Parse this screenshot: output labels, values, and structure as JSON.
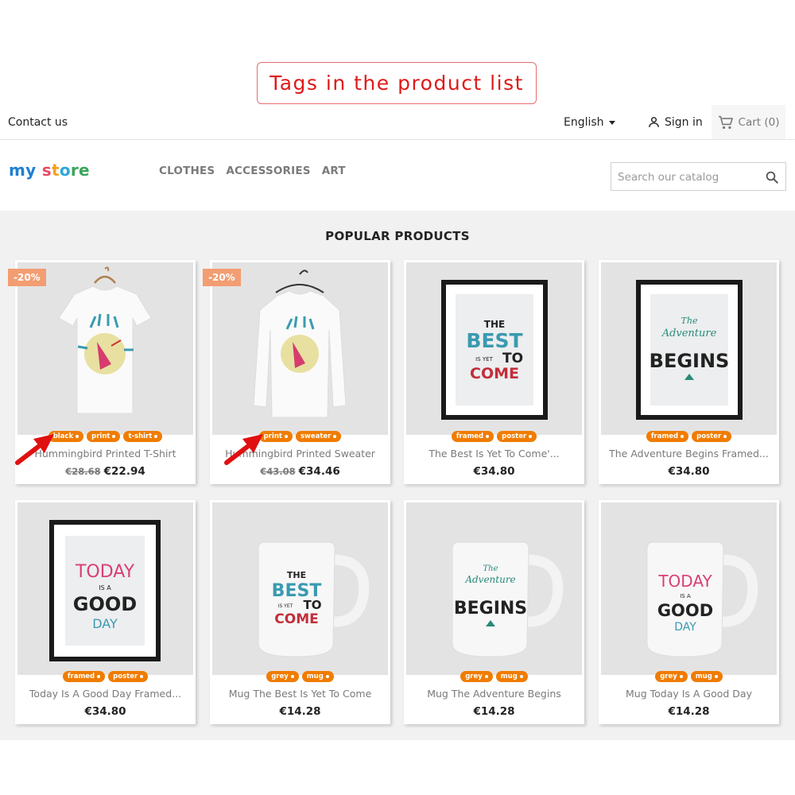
{
  "callout": {
    "text": "Tags in the product list"
  },
  "topbar": {
    "contact": "Contact us",
    "language": "English",
    "signin": "Sign in",
    "cart": "Cart (0)"
  },
  "header": {
    "logo": {
      "part1": "my",
      "part2": " s",
      "part3": "t",
      "part4": "o",
      "part5": "re"
    },
    "nav": [
      "CLOTHES",
      "ACCESSORIES",
      "ART"
    ],
    "search_placeholder": "Search our catalog"
  },
  "section_title": "POPULAR PRODUCTS",
  "products": [
    {
      "name": "Hummingbird Printed T-Shirt",
      "old_price": "€28.68",
      "price": "€22.94",
      "discount": "-20%",
      "tags": [
        "black",
        "print",
        "t-shirt"
      ],
      "image": "t-shirt"
    },
    {
      "name": "Hummingbird Printed Sweater",
      "old_price": "€43.08",
      "price": "€34.46",
      "discount": "-20%",
      "tags": [
        "print",
        "sweater"
      ],
      "image": "sweater"
    },
    {
      "name": "The Best Is Yet To Come'...",
      "price": "€34.80",
      "tags": [
        "framed",
        "poster"
      ],
      "image": "frame-best"
    },
    {
      "name": "The Adventure Begins Framed...",
      "price": "€34.80",
      "tags": [
        "framed",
        "poster"
      ],
      "image": "frame-adventure"
    },
    {
      "name": "Today Is A Good Day Framed...",
      "price": "€34.80",
      "tags": [
        "framed",
        "poster"
      ],
      "image": "frame-today"
    },
    {
      "name": "Mug The Best Is Yet To Come",
      "price": "€14.28",
      "tags": [
        "grey",
        "mug"
      ],
      "image": "mug-best"
    },
    {
      "name": "Mug The Adventure Begins",
      "price": "€14.28",
      "tags": [
        "grey",
        "mug"
      ],
      "image": "mug-adventure"
    },
    {
      "name": "Mug Today Is A Good Day",
      "price": "€14.28",
      "tags": [
        "grey",
        "mug"
      ],
      "image": "mug-today"
    }
  ],
  "artwork": {
    "best": [
      "THE",
      "BEST",
      "IS YET",
      "TO",
      "COME"
    ],
    "adventure": [
      "The",
      "Adventure",
      "BEGINS"
    ],
    "today": [
      "TODAY",
      "IS A",
      "GOOD",
      "DAY"
    ]
  },
  "colors": {
    "tag": "#f07c00",
    "discount": "#f39d72",
    "callout": "#e01919",
    "arrow": "#e01010"
  }
}
